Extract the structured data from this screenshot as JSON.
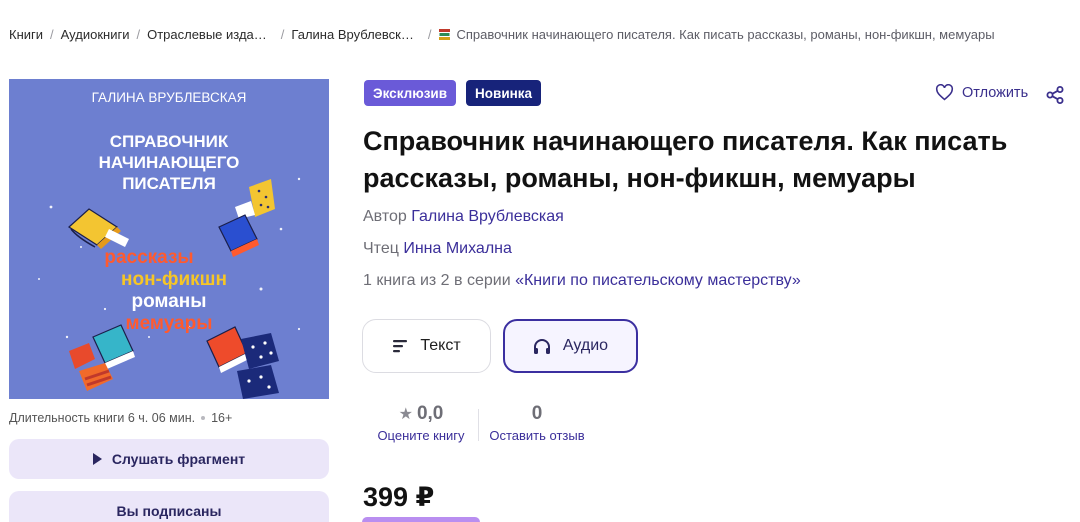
{
  "breadcrumbs": {
    "items": [
      "Книги",
      "Аудиокниги",
      "Отраслевые изда…",
      "Галина Врублевск…"
    ],
    "current": "Справочник начинающего писателя. Как писать рассказы, романы, нон-фикшн, мемуары"
  },
  "cover": {
    "author": "ГАЛИНА ВРУБЛЕВСКАЯ",
    "title_lines": [
      "СПРАВОЧНИК",
      "НАЧИНАЮЩЕГО",
      "ПИСАТЕЛЯ"
    ],
    "genres": [
      "рассказы",
      "нон-фикшн",
      "романы",
      "мемуары"
    ]
  },
  "meta": {
    "duration": "Длительность книги 6 ч. 06 мин.",
    "age": "16+"
  },
  "actions": {
    "listen": "Слушать фрагмент",
    "subscribed": "Вы подписаны"
  },
  "badges": {
    "exclusive": "Эксклюзив",
    "new": "Новинка"
  },
  "defer_label": "Отложить",
  "book": {
    "title": "Справочник начинающего писателя. Как писать рассказы, романы, нон-фикшн, мемуары",
    "author_label": "Автор",
    "author": "Галина Врублевская",
    "reader_label": "Чтец",
    "reader": "Инна Михална",
    "series_label": "1 книга из 2 в серии",
    "series": "«Книги по писательскому мастерству»"
  },
  "formats": {
    "text": "Текст",
    "audio": "Аудио"
  },
  "rating": {
    "value": "0,0",
    "rate_label": "Оцените книгу",
    "reviews": "0",
    "review_label": "Оставить отзыв"
  },
  "price": "399 ₽",
  "colors": {
    "accent": "#3b2fa0",
    "exclusive": "#6a5ad8",
    "new": "#17237a",
    "cover_bg": "#6d7fd0"
  },
  "icons": [
    "book-stack-icon",
    "heart-icon",
    "share-icon",
    "play-icon",
    "text-lines-icon",
    "headphones-icon",
    "star-icon"
  ]
}
